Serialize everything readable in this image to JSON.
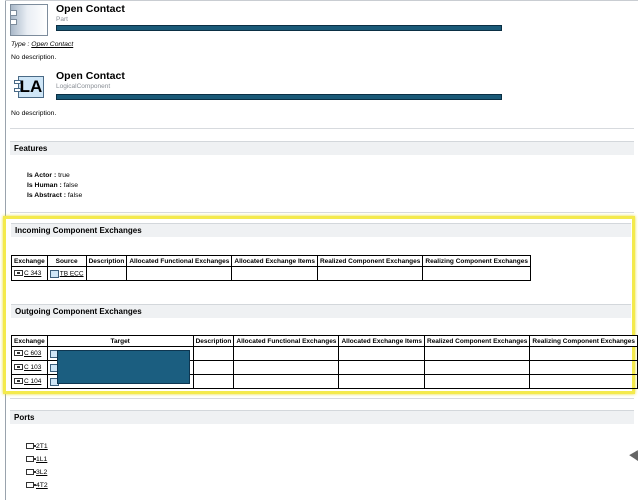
{
  "part": {
    "title": "Open Contact",
    "subtitle": "Part",
    "type_label": "Type : ",
    "type_link": "Open Contact",
    "description": "No description."
  },
  "logical": {
    "icon_text": "LA",
    "title": "Open Contact",
    "subtitle": "LogicalComponent",
    "description": "No description."
  },
  "features": {
    "heading": "Features",
    "items": [
      {
        "label": "Is Actor :",
        "value": " true"
      },
      {
        "label": "Is Human :",
        "value": " false"
      },
      {
        "label": "Is Abstract :",
        "value": " false"
      }
    ]
  },
  "incoming": {
    "heading": "Incoming Component Exchanges",
    "columns": [
      "Exchange",
      "Source",
      "Description",
      "Allocated Functional Exchanges",
      "Allocated Exchange Items",
      "Realized Component Exchanges",
      "Realizing Component Exchanges"
    ],
    "rows": [
      {
        "exchange": "C 343",
        "source": "TB ECC"
      }
    ]
  },
  "outgoing": {
    "heading": "Outgoing Component Exchanges",
    "columns": [
      "Exchange",
      "Target",
      "Description",
      "Allocated Functional Exchanges",
      "Allocated Exchange Items",
      "Realized Component Exchanges",
      "Realizing Component Exchanges"
    ],
    "rows": [
      {
        "exchange": "C 603"
      },
      {
        "exchange": "C 103"
      },
      {
        "exchange": "C 104"
      }
    ]
  },
  "ports": {
    "heading": "Ports",
    "items": [
      "2T1",
      "1L1",
      "3L2",
      "4T2"
    ]
  },
  "colors": {
    "header_bar": "#1a5a78",
    "highlight": "#f4ea4c",
    "redaction": "#1b5e80"
  }
}
